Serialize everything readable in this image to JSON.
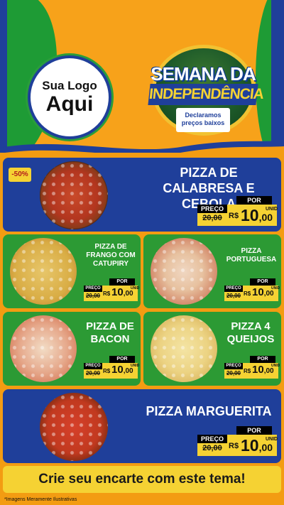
{
  "header": {
    "logo_line1": "Sua Logo",
    "logo_line2": "Aqui",
    "seal_line1": "SEMANA DA",
    "seal_line2": "INDEPENDÊNCIA",
    "seal_line3": "Declaramos preços baixos"
  },
  "products": [
    {
      "name": "PIZZA DE CALABRESA E CEBOLA",
      "discount": "-50%",
      "por": "POR",
      "preco": "PREÇO",
      "old_price": "20,00",
      "currency": "R$",
      "price_int": "10",
      "price_dec": ",00",
      "unit": "UNID"
    },
    {
      "name": "PIZZA DE FRANGO COM CATUPIRY",
      "por": "POR",
      "preco": "PREÇO",
      "old_price": "20,00",
      "currency": "R$",
      "price_int": "10",
      "price_dec": ",00",
      "unit": "UNID"
    },
    {
      "name": "PIZZA PORTUGUESA",
      "por": "POR",
      "preco": "PREÇO",
      "old_price": "20,00",
      "currency": "R$",
      "price_int": "10",
      "price_dec": ",00",
      "unit": "UNID"
    },
    {
      "name": "PIZZA DE BACON",
      "por": "POR",
      "preco": "PREÇO",
      "old_price": "20,00",
      "currency": "R$",
      "price_int": "10",
      "price_dec": ",00",
      "unit": "UNID"
    },
    {
      "name": "PIZZA 4 QUEIJOS",
      "por": "POR",
      "preco": "PREÇO",
      "old_price": "20,00",
      "currency": "R$",
      "price_int": "10",
      "price_dec": ",00",
      "unit": "UNID"
    },
    {
      "name": "PIZZA MARGUERITA",
      "por": "POR",
      "preco": "PREÇO",
      "old_price": "20,00",
      "currency": "R$",
      "price_int": "10",
      "price_dec": ",00",
      "unit": "UNID"
    }
  ],
  "footer": {
    "cta": "Crie seu encarte com este tema!",
    "disclaimer": "*Imagens Meramente Ilustrativas"
  },
  "colors": {
    "blue": "#1f3f9a",
    "green": "#2c9a34",
    "orange": "#f39c12",
    "yellow": "#f5d233"
  }
}
